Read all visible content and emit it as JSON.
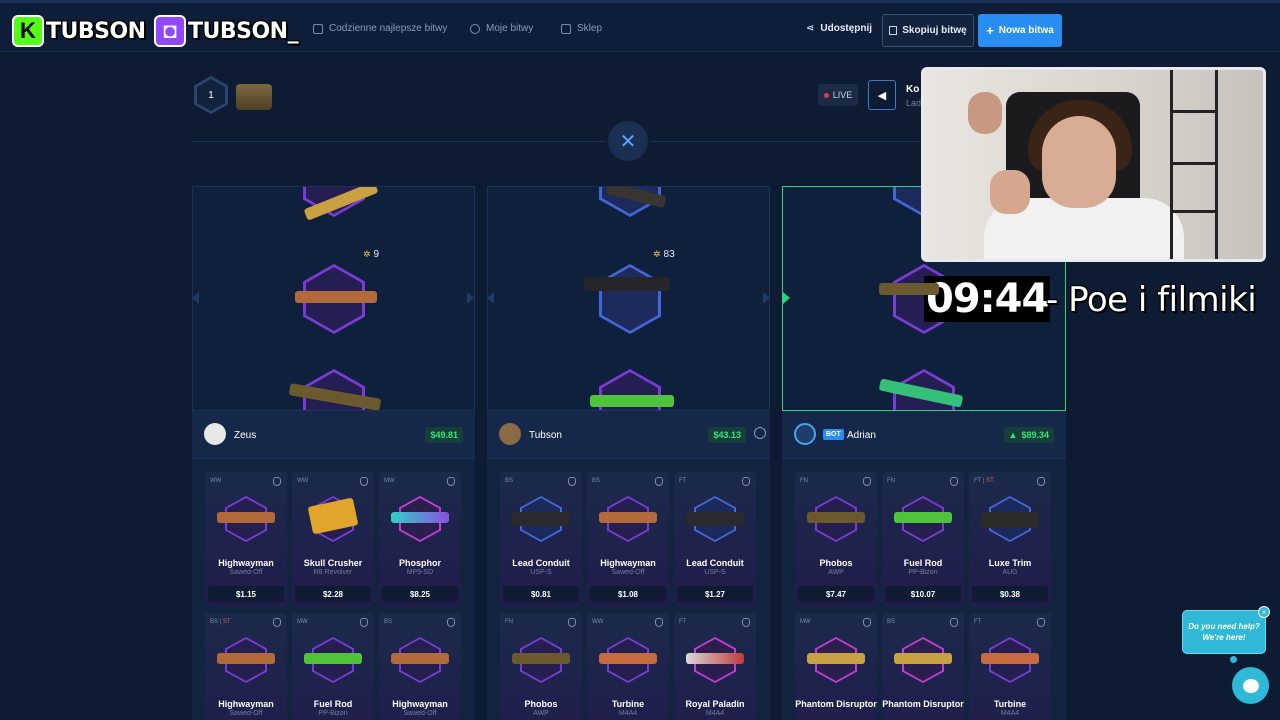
{
  "nav": {
    "items": [
      {
        "label": "Codzienne najlepsze bitwy",
        "icon": "trophy-icon"
      },
      {
        "label": "Moje bitwy",
        "icon": "history-icon"
      },
      {
        "label": "Sklep",
        "icon": "shop-icon"
      }
    ],
    "share_label": "Udostępnij",
    "copy_label": "Skopiuj bitwę",
    "new_label": "Nowa bitwa"
  },
  "overlay": {
    "kick_name": "TUBSON",
    "twitch_name": "TUBSON_",
    "timer": "09:44",
    "timer_text": "- Poe i filmiki"
  },
  "battle": {
    "round": "1",
    "live_label": "LIVE",
    "cut_title": "Ko",
    "cut_sub": "Lad"
  },
  "reels": [
    {
      "count": "9"
    },
    {
      "count": "83"
    },
    {
      "count": ""
    }
  ],
  "players": [
    {
      "name": "Zeus",
      "value": "$49.81",
      "bot": false,
      "items": [
        {
          "cond": "WW",
          "st": "",
          "name": "Highwayman",
          "sub": "Sawed-Off",
          "price": "$1.15"
        },
        {
          "cond": "WW",
          "st": "",
          "name": "Skull Crusher",
          "sub": "R8 Revolver",
          "price": "$2.28"
        },
        {
          "cond": "MW",
          "st": "",
          "name": "Phosphor",
          "sub": "MP5-SD",
          "price": "$8.25"
        },
        {
          "cond": "BS | ",
          "st": "ST",
          "name": "Highwayman",
          "sub": "Sawed-Off",
          "price": ""
        },
        {
          "cond": "MW",
          "st": "",
          "name": "Fuel Rod",
          "sub": "PP-Bizon",
          "price": ""
        },
        {
          "cond": "BS",
          "st": "",
          "name": "Highwayman",
          "sub": "Sawed-Off",
          "price": ""
        }
      ]
    },
    {
      "name": "Tubson",
      "value": "$43.13",
      "bot": false,
      "items": [
        {
          "cond": "BS",
          "st": "",
          "name": "Lead Conduit",
          "sub": "USP-S",
          "price": "$0.81"
        },
        {
          "cond": "BS",
          "st": "",
          "name": "Highwayman",
          "sub": "Sawed-Off",
          "price": "$1.08"
        },
        {
          "cond": "FT",
          "st": "",
          "name": "Lead Conduit",
          "sub": "USP-S",
          "price": "$1.27"
        },
        {
          "cond": "FN",
          "st": "",
          "name": "Phobos",
          "sub": "AWP",
          "price": ""
        },
        {
          "cond": "WW",
          "st": "",
          "name": "Turbine",
          "sub": "M4A4",
          "price": ""
        },
        {
          "cond": "FT",
          "st": "",
          "name": "Royal Paladin",
          "sub": "M4A4",
          "price": ""
        }
      ]
    },
    {
      "name": "Adrian",
      "value": "$89.34",
      "bot": true,
      "bot_label": "BOT",
      "items": [
        {
          "cond": "FN",
          "st": "",
          "name": "Phobos",
          "sub": "AWP",
          "price": "$7.47"
        },
        {
          "cond": "FN",
          "st": "",
          "name": "Fuel Rod",
          "sub": "PP-Bizon",
          "price": "$10.07"
        },
        {
          "cond": "FT | ",
          "st": "ST",
          "name": "Luxe Trim",
          "sub": "AUG",
          "price": "$0.38"
        },
        {
          "cond": "MW",
          "st": "",
          "name": "Phantom Disruptor",
          "sub": "",
          "price": ""
        },
        {
          "cond": "BS",
          "st": "",
          "name": "Phantom Disruptor",
          "sub": "",
          "price": ""
        },
        {
          "cond": "FT",
          "st": "",
          "name": "Turbine",
          "sub": "M4A4",
          "price": ""
        }
      ]
    }
  ],
  "help": {
    "line1": "Do you need help?",
    "line2": "We're here!"
  }
}
